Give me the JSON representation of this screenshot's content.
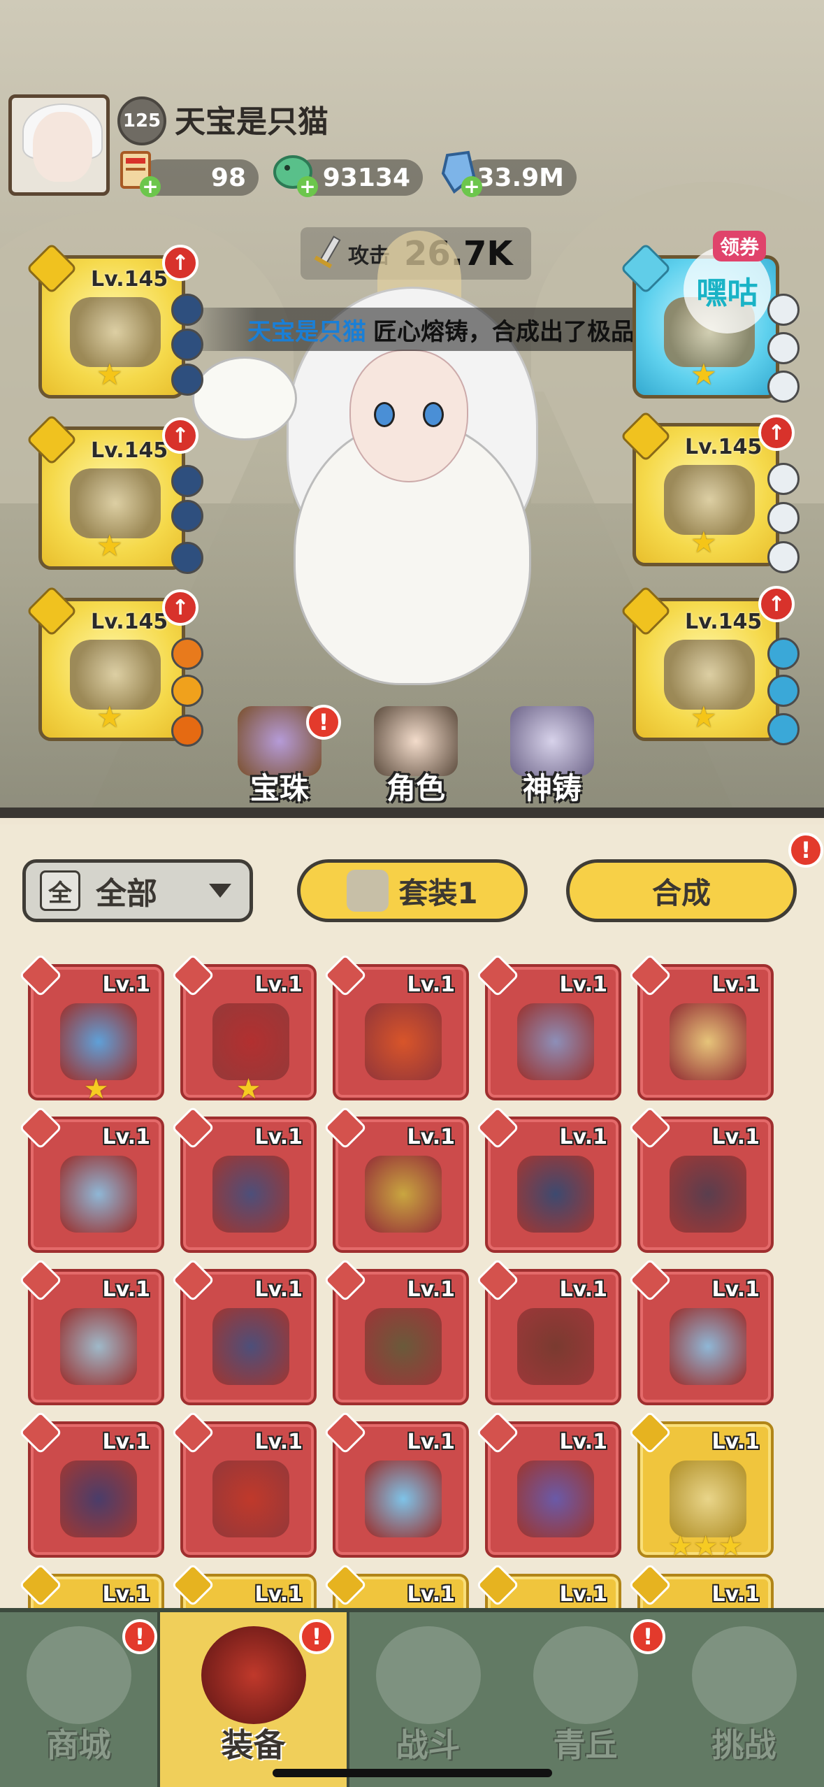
{
  "player": {
    "level": "125",
    "name": "天宝是只猫",
    "resources": {
      "tickets": "98",
      "jade": "93134",
      "crystal": "33.9M"
    },
    "attack_label": "攻击",
    "attack_value": "26.7K"
  },
  "announcement": {
    "highlight": "天宝是只猫",
    "text": "匠心熔铸，合成出了极品装备"
  },
  "coupon": {
    "tag": "领券",
    "brand": "嘿咕"
  },
  "equipped_slots": [
    {
      "lv": "Lv.145",
      "tint": "#e8be2c"
    },
    {
      "lv": "Lv.145",
      "tint": "#e8be2c"
    },
    {
      "lv": "Lv.145",
      "tint": "#e8be2c"
    },
    {
      "lv": "",
      "tint": "#33a9cf"
    },
    {
      "lv": "Lv.145",
      "tint": "#e8be2c"
    },
    {
      "lv": "Lv.145",
      "tint": "#e8be2c"
    }
  ],
  "scene_buttons": {
    "orbs": "宝珠",
    "character": "角色",
    "forge": "神铸"
  },
  "inventory": {
    "filter_chip": "全",
    "filter_label": "全部",
    "set_button": "套装1",
    "synth_button": "合成",
    "items": [
      {
        "lv": "Lv.1",
        "stars": "★",
        "art": "#5fa0d8"
      },
      {
        "lv": "Lv.1",
        "stars": "★",
        "art": "#b23030"
      },
      {
        "lv": "Lv.1",
        "stars": "",
        "art": "#d8552a"
      },
      {
        "lv": "Lv.1",
        "stars": "",
        "art": "#8d8fb8"
      },
      {
        "lv": "Lv.1",
        "stars": "",
        "art": "#e6c47a"
      },
      {
        "lv": "Lv.1",
        "stars": "",
        "art": "#8fb7d6"
      },
      {
        "lv": "Lv.1",
        "stars": "",
        "art": "#4d4f7a"
      },
      {
        "lv": "Lv.1",
        "stars": "",
        "art": "#c9a640"
      },
      {
        "lv": "Lv.1",
        "stars": "",
        "art": "#3d4a70"
      },
      {
        "lv": "Lv.1",
        "stars": "",
        "art": "#5a3e4e"
      },
      {
        "lv": "Lv.1",
        "stars": "",
        "art": "#9fb9c9"
      },
      {
        "lv": "Lv.1",
        "stars": "",
        "art": "#4d4f7a"
      },
      {
        "lv": "Lv.1",
        "stars": "",
        "art": "#6a5a3a"
      },
      {
        "lv": "Lv.1",
        "stars": "",
        "art": "#7a3a30"
      },
      {
        "lv": "Lv.1",
        "stars": "",
        "art": "#8fb7d6"
      },
      {
        "lv": "Lv.1",
        "stars": "",
        "art": "#4a3d6a"
      },
      {
        "lv": "Lv.1",
        "stars": "",
        "art": "#c0392b"
      },
      {
        "lv": "Lv.1",
        "stars": "",
        "art": "#7ec3e8"
      },
      {
        "lv": "Lv.1",
        "stars": "",
        "art": "#6a5aa8"
      },
      {
        "lv": "Lv.1",
        "stars": "★★★",
        "art": "#e9d58a",
        "gold": true
      },
      {
        "lv": "Lv.1",
        "stars": "",
        "art": "#e6c44a",
        "gold": true
      },
      {
        "lv": "Lv.1",
        "stars": "",
        "art": "#e6c44a",
        "gold": true
      },
      {
        "lv": "Lv.1",
        "stars": "",
        "art": "#e6c44a",
        "gold": true
      },
      {
        "lv": "Lv.1",
        "stars": "",
        "art": "#e6c44a",
        "gold": true
      },
      {
        "lv": "Lv.1",
        "stars": "",
        "art": "#e6c44a",
        "gold": true
      }
    ]
  },
  "nav": [
    {
      "label": "商城",
      "icon": "pagoda-icon"
    },
    {
      "label": "装备",
      "icon": "helmet-icon"
    },
    {
      "label": "战斗",
      "icon": "crossed-swords-icon"
    },
    {
      "label": "青丘",
      "icon": "mountain-icon"
    },
    {
      "label": "挑战",
      "icon": "disc-icon"
    }
  ],
  "alert_mark": "!",
  "up_mark": "↑",
  "plus_mark": "+",
  "star_mark": "★"
}
